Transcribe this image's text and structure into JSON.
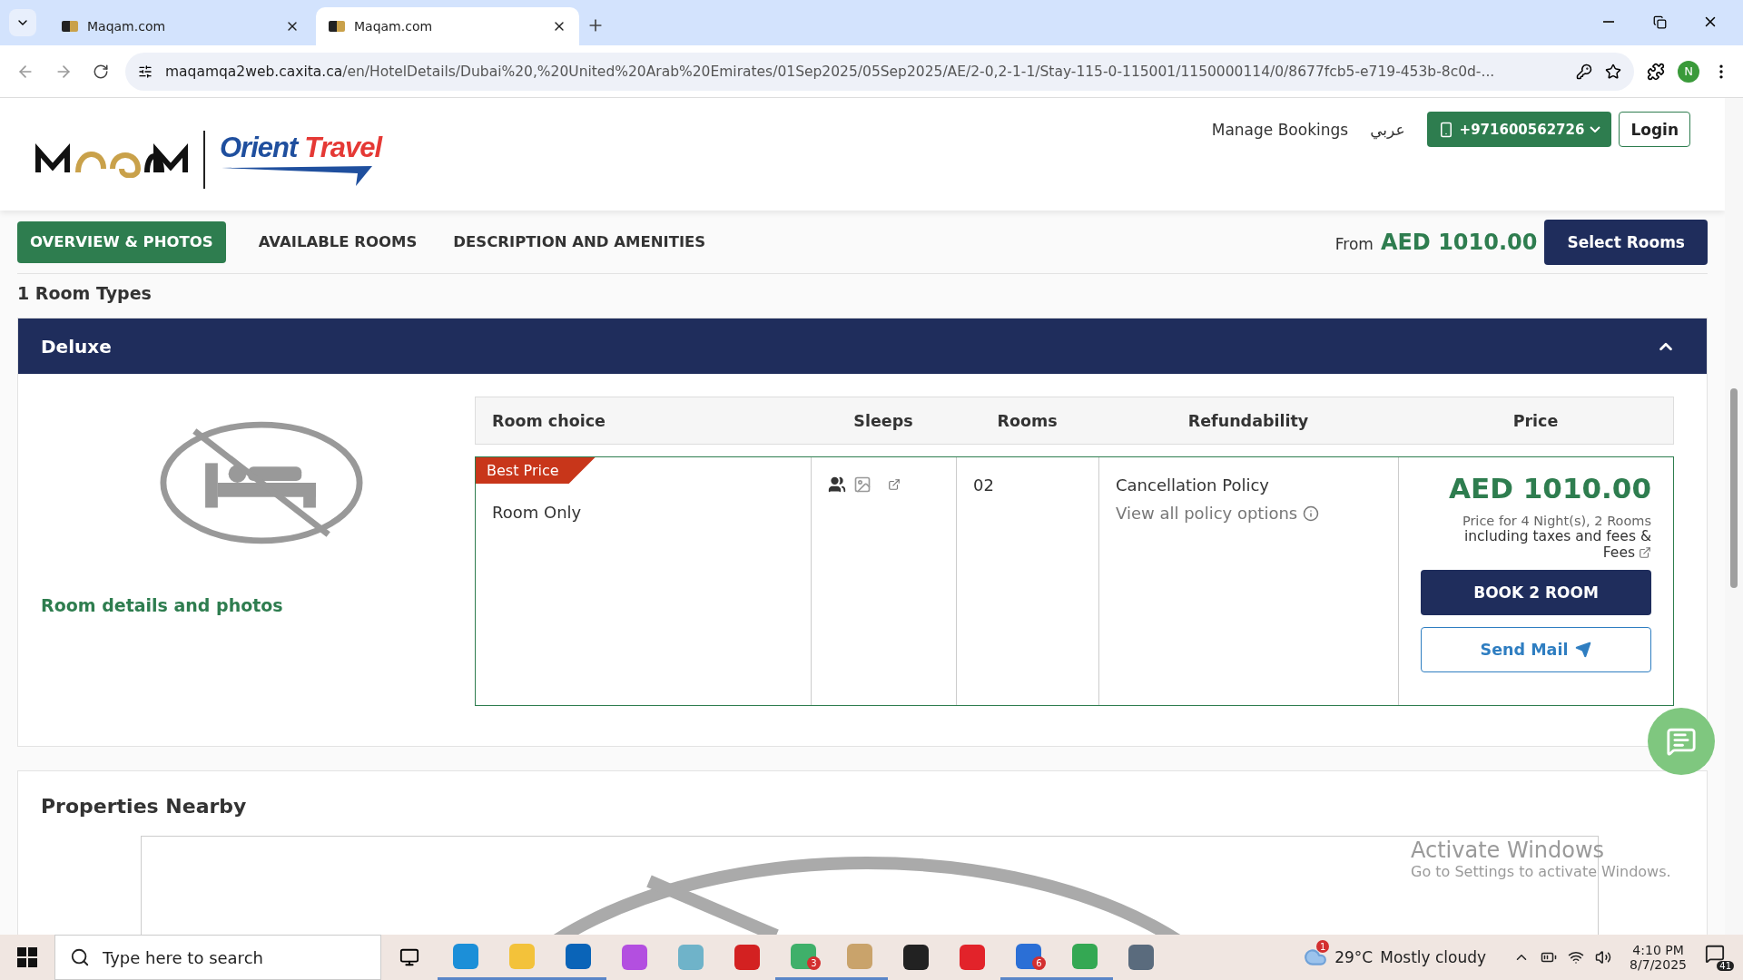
{
  "browser": {
    "tabs": [
      {
        "title": "Maqam.com",
        "selected": false
      },
      {
        "title": "Maqam.com",
        "selected": true
      }
    ],
    "url_host": "maqamqa2web.caxita.ca",
    "url_path": "/en/HotelDetails/Dubai%20,%20United%20Arab%20Emirates/01Sep2025/05Sep2025/AE/2-0,2-1-1/Stay-115-0-115001/1150000114/0/8677fcb5-e719-453b-8c0d-...",
    "profile_initial": "N"
  },
  "header": {
    "brand_words": [
      "Orient",
      "Travel"
    ],
    "manage_bookings": "Manage Bookings",
    "language": "عربي",
    "phone": "+971600562726",
    "login": "Login"
  },
  "subnav": {
    "tabs": [
      {
        "label": "OVERVIEW & PHOTOS",
        "selected": true
      },
      {
        "label": "AVAILABLE ROOMS",
        "selected": false
      },
      {
        "label": "DESCRIPTION AND AMENITIES",
        "selected": false
      }
    ],
    "from_label": "From",
    "from_price": "AED 1010.00",
    "cta": "Select Rooms"
  },
  "room_types_count": "1 Room Types",
  "room": {
    "name": "Deluxe",
    "expanded": true,
    "details_link": "Room details and photos",
    "columns": [
      "Room choice",
      "Sleeps",
      "Rooms",
      "Refundability",
      "Price"
    ],
    "rows": [
      {
        "badge": "Best Price",
        "choice": "Room Only",
        "rooms": "02",
        "policy_title": "Cancellation Policy",
        "policy_link": "View all policy options",
        "price": "AED 1010.00",
        "price_note": "Price for 4 Night(s), 2 Rooms",
        "price_note_2": "including taxes and fees &",
        "price_note_3": "Fees",
        "book": "BOOK 2 ROOM",
        "mail": "Send Mail"
      }
    ]
  },
  "properties_nearby": {
    "title": "Properties Nearby"
  },
  "os_notice": {
    "title": "Activate Windows",
    "subtitle": "Go to Settings to activate Windows."
  },
  "taskbar": {
    "search_placeholder": "Type here to search",
    "apps": [
      {
        "color": "#1c8fd8"
      },
      {
        "color": "#f3c23a"
      },
      {
        "color": "#0a64b8"
      },
      {
        "color": "#b34fe0"
      },
      {
        "color": "#6fb3c9"
      },
      {
        "color": "#d32121"
      },
      {
        "color": "#3fb06a",
        "badge": "3"
      },
      {
        "color": "#c9a36b"
      },
      {
        "color": "#222222"
      },
      {
        "color": "#e2232a"
      },
      {
        "color": "#2b6fd6",
        "badge": "6"
      },
      {
        "color": "#34a853"
      },
      {
        "color": "#5a6b7d"
      }
    ],
    "weather_alert": "1",
    "temperature": "29°C",
    "condition": "Mostly cloudy",
    "time": "4:10 PM",
    "date": "8/7/2025",
    "notifications": "41"
  }
}
